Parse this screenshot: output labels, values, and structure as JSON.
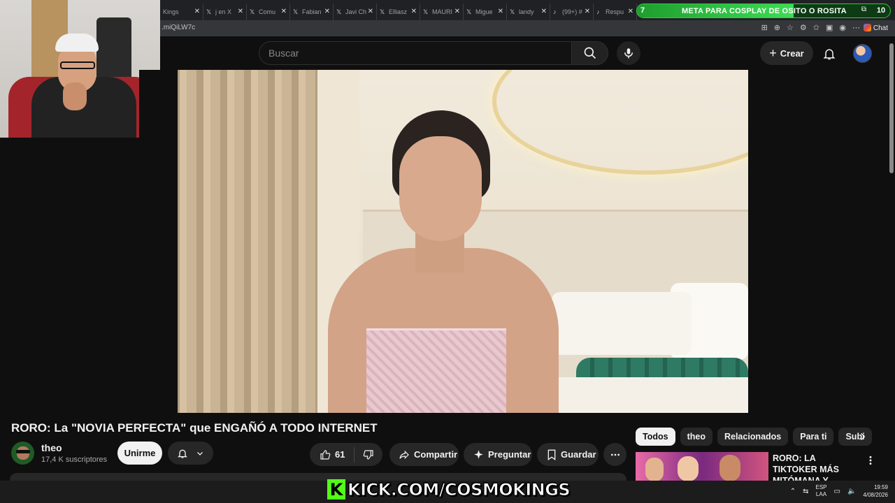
{
  "browser": {
    "tabs": [
      {
        "title": "Kings"
      },
      {
        "title": "j en X"
      },
      {
        "title": "Comu"
      },
      {
        "title": "Fabian"
      },
      {
        "title": "Javi Ch"
      },
      {
        "title": "Elliasz"
      },
      {
        "title": "MAURI"
      },
      {
        "title": "Migue"
      },
      {
        "title": "landy"
      },
      {
        "title": "(99+) #"
      },
      {
        "title": "Respu"
      }
    ],
    "url_fragment": ".miQiLW7c",
    "chat_label": "Chat"
  },
  "stream_goal": {
    "level": "7",
    "text": "META PARA COSPLAY DE OSITO O ROSITA",
    "count": "10",
    "progress": 0.62,
    "accent": "#3ddc54"
  },
  "youtube": {
    "search_placeholder": "Buscar",
    "create_label": "Crear",
    "icons": [
      "search-icon",
      "mic-icon",
      "bell-icon",
      "plus-icon"
    ]
  },
  "video": {
    "title": "RORO: La \"NOVIA PERFECTA\" que ENGAÑÓ A TODO INTERNET",
    "channel_name": "theo",
    "subscribers": "17,4 K suscriptores",
    "join_label": "Unirme",
    "likes": "61",
    "share_label": "Compartir",
    "ask_label": "Preguntar",
    "save_label": "Guardar"
  },
  "sidebar": {
    "chips": [
      {
        "label": "Todos",
        "active": true
      },
      {
        "label": "theo",
        "active": false
      },
      {
        "label": "Relacionados",
        "active": false
      },
      {
        "label": "Para ti",
        "active": false
      },
      {
        "label": "Subi",
        "active": false
      }
    ],
    "reco_title": "RORO: LA TIKTOKER MÁS MITÓMANA Y ..."
  },
  "overlay": {
    "kick_text": "KICK.COM/COSMOKINGS",
    "kick_logo": "K",
    "kick_color": "#53fc18"
  },
  "taskbar": {
    "lang_top": "ESP",
    "lang_bottom": "LAA",
    "time": "19:59",
    "date": "4/08/2026"
  }
}
